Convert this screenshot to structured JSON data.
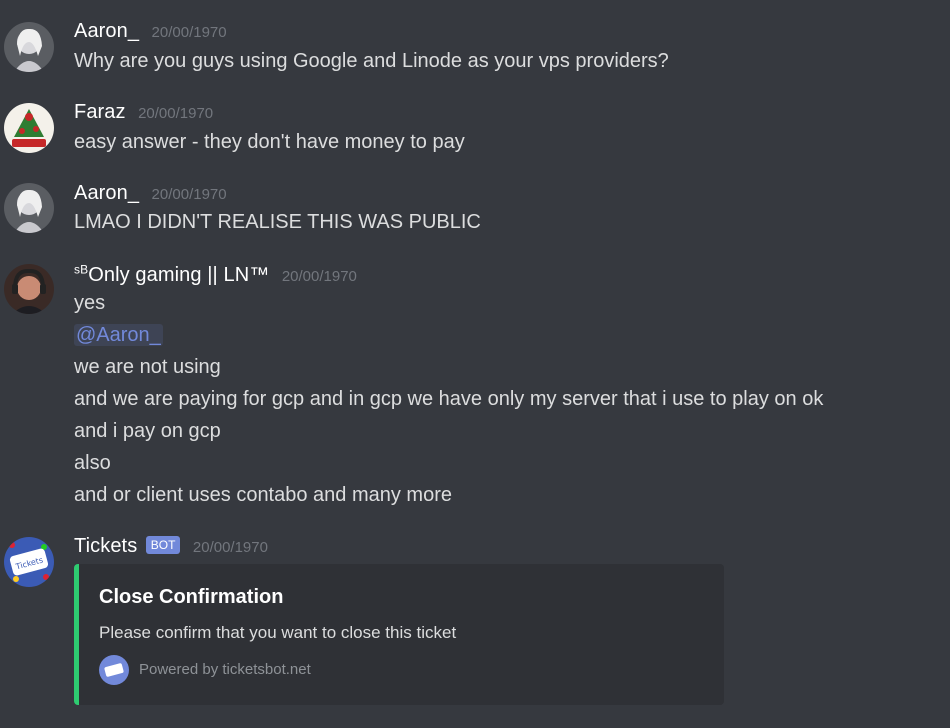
{
  "messages": [
    {
      "username": "Aaron_",
      "timestamp": "20/00/1970",
      "avatar_icon": "anime-character-avatar",
      "lines": [
        "Why are you guys using Google and Linode as your vps providers?"
      ]
    },
    {
      "username": "Faraz",
      "timestamp": "20/00/1970",
      "avatar_icon": "christmas-card-avatar",
      "lines": [
        "easy answer - they don't have money to pay"
      ]
    },
    {
      "username": "Aaron_",
      "timestamp": "20/00/1970",
      "avatar_icon": "anime-character-avatar",
      "lines": [
        "LMAO I DIDN'T REALISE THIS WAS PUBLIC"
      ]
    },
    {
      "username_prefix": "sB",
      "username": "Only gaming || LN™",
      "timestamp": "20/00/1970",
      "avatar_icon": "person-with-headset-avatar",
      "lines": [
        "yes",
        "@Aaron_",
        "we are not using",
        "and we are paying for gcp and in gcp we have only my server that i use to play on ok",
        "and i pay on gcp",
        "also",
        "and or client uses contabo and many more"
      ]
    },
    {
      "username": "Tickets",
      "bot_tag": "BOT",
      "timestamp": "20/00/1970",
      "avatar_icon": "tickets-bot-avatar",
      "embed": {
        "title": "Close Confirmation",
        "description": "Please confirm that you want to close this ticket",
        "footer_text": "Powered by ticketsbot.net",
        "footer_icon": "ticketsbot-logo-icon",
        "accent_color": "#2ecc71"
      }
    }
  ],
  "colors": {
    "background": "#36393f",
    "username": "#ffffff",
    "timestamp": "#72767d",
    "message_text": "#dcddde",
    "mention": "#7289da",
    "bot_tag": "#7289da",
    "embed_background": "#2f3136"
  }
}
